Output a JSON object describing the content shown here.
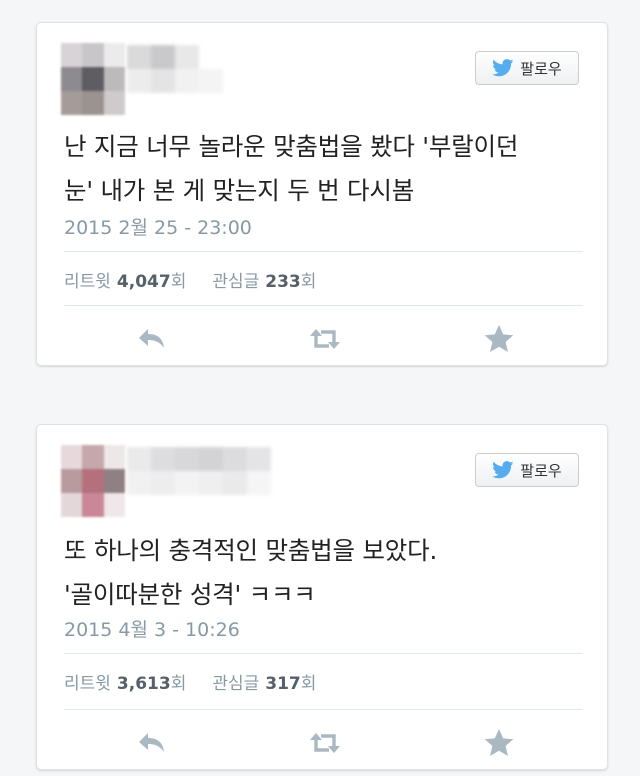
{
  "tweets": [
    {
      "follow_label": "팔로우",
      "text_line1": "난 지금 너무 놀라운 맞춤법을 봤다 '부랄이던",
      "text_line2": "눈' 내가 본 게 맞는지 두 번 다시봄",
      "timestamp": "2015 2월 25 - 23:00",
      "retweet_label": "리트윗",
      "retweet_count": "4,047",
      "retweet_unit": "회",
      "fav_label": "관심글",
      "fav_count": "233",
      "fav_unit": "회"
    },
    {
      "follow_label": "팔로우",
      "text_line1": "또 하나의 충격적인 맞춤법을 보았다.",
      "text_line2": "'골이따분한 성격' ㅋㅋㅋ",
      "timestamp": "2015 4월 3 - 10:26",
      "retweet_label": "리트윗",
      "retweet_count": "3,613",
      "retweet_unit": "회",
      "fav_label": "관심글",
      "fav_count": "317",
      "fav_unit": "회"
    }
  ],
  "icons": {
    "follow": "twitter-bird-icon",
    "reply": "reply-icon",
    "retweet": "retweet-icon",
    "favorite": "star-icon"
  },
  "colors": {
    "bird": "#55acee",
    "action_icon": "#aab8c2",
    "muted_text": "#8899a6"
  }
}
